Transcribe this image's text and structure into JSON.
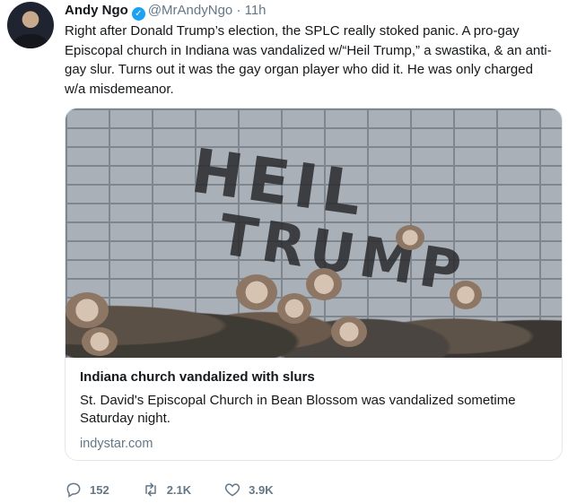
{
  "tweet": {
    "author_name": "Andy Ngo",
    "handle": "@MrAndyNgo",
    "separator": "·",
    "time": "11h",
    "text": "Right after Donald Trump’s election, the SPLC really stoked panic. A pro-gay Episcopal church in Indiana was vandalized w/“Heil Trump,” a swastika, & an anti-gay slur. Turns out it was the gay organ player who did it. He was only charged w/a misdemeanor."
  },
  "card": {
    "image_graffiti_line1": "HEIL",
    "image_graffiti_line2": "TRUMP",
    "title": "Indiana church vandalized with slurs",
    "description": "St. David's Episcopal Church in Bean Blossom was vandalized sometime Saturday night.",
    "domain": "indystar.com"
  },
  "actions": {
    "replies": "152",
    "retweets": "2.1K",
    "likes": "3.9K"
  },
  "icons": {
    "verified": "verified-badge-icon",
    "reply": "reply-icon",
    "retweet": "retweet-icon",
    "like": "heart-icon"
  },
  "colors": {
    "accent": "#1da1f2",
    "muted": "#657786",
    "text": "#14171a",
    "border": "#e1e8ed"
  }
}
